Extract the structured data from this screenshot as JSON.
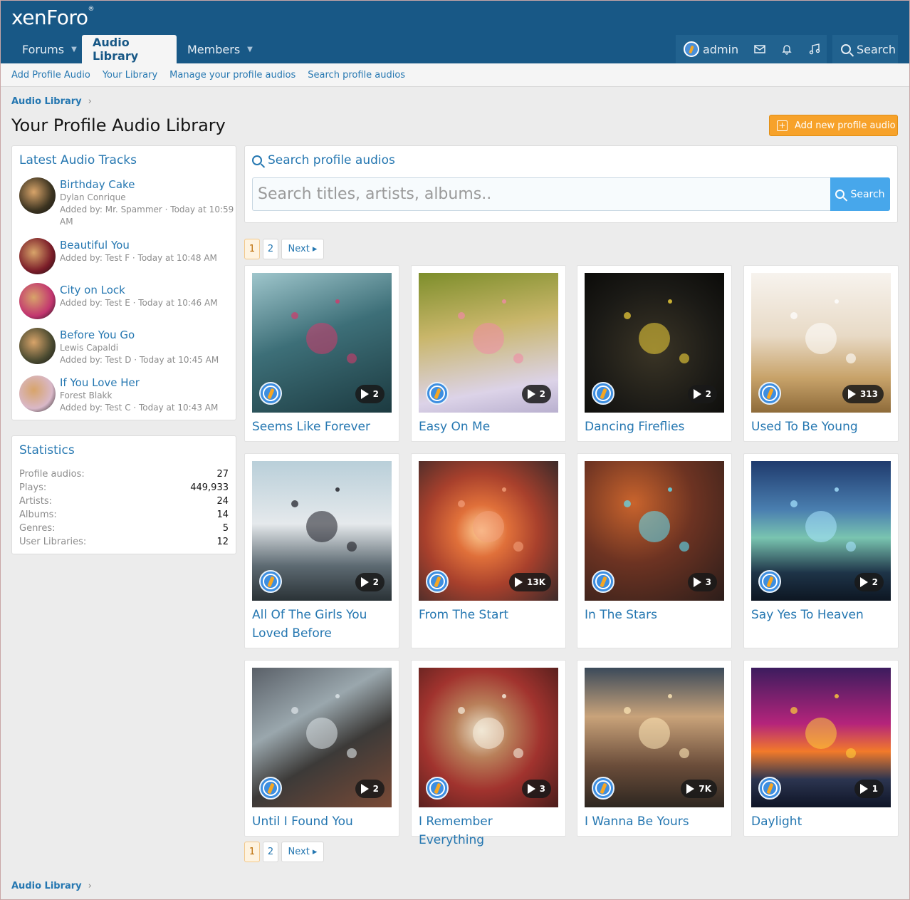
{
  "header": {
    "logo": "xenForo",
    "nav": [
      {
        "label": "Forums"
      },
      {
        "label": "Audio Library"
      },
      {
        "label": "Members"
      }
    ],
    "user": {
      "name": "admin",
      "search_label": "Search"
    }
  },
  "subnav": [
    "Add Profile Audio",
    "Your Library",
    "Manage your profile audios",
    "Search profile audios"
  ],
  "breadcrumb": "Audio Library",
  "page_title": "Your Profile Audio Library",
  "add_button": "Add new profile audio",
  "latest": {
    "title": "Latest Audio Tracks",
    "tracks": [
      {
        "title": "Birthday Cake",
        "artist": "Dylan Conrique",
        "added": "Added by: Mr. Spammer · Today at 10:59",
        "added2": "AM",
        "color": "#3b3320"
      },
      {
        "title": "Beautiful You",
        "artist": "",
        "added": "Added by: Test F · Today at 10:48 AM",
        "added2": "",
        "color": "#7a1c28"
      },
      {
        "title": "City on Lock",
        "artist": "",
        "added": "Added by: Test E · Today at 10:46 AM",
        "added2": "",
        "color": "#c2356f"
      },
      {
        "title": "Before You Go",
        "artist": "Lewis Capaldi",
        "added": "Added by: Test D · Today at 10:45 AM",
        "added2": "",
        "color": "#4a4a30"
      },
      {
        "title": "If You Love Her",
        "artist": "Forest Blakk",
        "added": "Added by: Test C · Today at 10:43 AM",
        "added2": "",
        "color": "#d9b8c8"
      }
    ]
  },
  "stats": {
    "title": "Statistics",
    "rows": [
      {
        "label": "Profile audios:",
        "value": "27"
      },
      {
        "label": "Plays:",
        "value": "449,933"
      },
      {
        "label": "Artists:",
        "value": "24"
      },
      {
        "label": "Albums:",
        "value": "14"
      },
      {
        "label": "Genres:",
        "value": "5"
      },
      {
        "label": "User Libraries:",
        "value": "12"
      }
    ]
  },
  "search": {
    "title": "Search profile audios",
    "placeholder": "Search titles, artists, albums..",
    "button": "Search"
  },
  "pager": {
    "pages": [
      "1",
      "2"
    ],
    "next": "Next ▸"
  },
  "cards": [
    {
      "name": "Seems Like Forever",
      "plays": "2",
      "bg": "linear-gradient(160deg,#9fc6cc 0%,#3d6f78 45%,#1c3a40 100%)",
      "accent": "#d13a6b"
    },
    {
      "name": "Easy On Me",
      "plays": "2",
      "bg": "linear-gradient(170deg,#7d8e2b 0%,#c9b66a 40%,#dcd3e8 80%,#b9b0cf 100%)",
      "accent": "#f08aa5"
    },
    {
      "name": "Dancing Fireflies",
      "plays": "2",
      "bg": "radial-gradient(circle at 50% 55%,#3b3526 0%,#1b1a16 60%,#0b0b09 100%)",
      "accent": "#f3d33a"
    },
    {
      "name": "Used To Be Young",
      "plays": "313",
      "bg": "linear-gradient(180deg,#f7f3ee 0%,#e8dac6 45%,#c8a36a 75%,#8e6b3a 100%)",
      "accent": "#ffffff"
    },
    {
      "name": "All Of The Girls You Loved Before",
      "plays": "2",
      "bg": "linear-gradient(180deg,#b9cfd9 0%,#e5e9ec 45%,#5d6a72 75%,#2a3236 100%)",
      "accent": "#1a1a22"
    },
    {
      "name": "From The Start",
      "plays": "13K",
      "bg": "radial-gradient(circle at 45% 50%,#ffd29a 0%,#e0703a 25%,#a8402c 55%,#3b2a2a 100%)",
      "accent": "#f3a07a"
    },
    {
      "name": "In The Stars",
      "plays": "3",
      "bg": "radial-gradient(circle at 35% 30%,#c9642d 0%,#6d3322 45%,#2b1d1a 100%)",
      "accent": "#5ee0f5"
    },
    {
      "name": "Say Yes To Heaven",
      "plays": "2",
      "bg": "linear-gradient(180deg,#1f3a6d 0%,#4a7fb0 35%,#79c4b0 55%,#1e3448 80%,#0d1622 100%)",
      "accent": "#a7e4ff"
    },
    {
      "name": "Until I Found You",
      "plays": "2",
      "bg": "linear-gradient(150deg,#5a6068 0%,#9aa7ad 35%,#3c3a38 60%,#7a4a36 100%)",
      "accent": "#dfe6ea"
    },
    {
      "name": "I Remember Everything",
      "plays": "3",
      "bg": "radial-gradient(circle at 45% 45%,#e9dfc7 0%,#b9805a 25%,#a1332e 55%,#4a1c1a 100%)",
      "accent": "#f7efe0"
    },
    {
      "name": "I Wanna Be Yours",
      "plays": "7K",
      "bg": "linear-gradient(180deg,#3b4a5a 0%,#c9a37a 35%,#6b4d3a 70%,#2d2620 100%)",
      "accent": "#ffe8b8"
    },
    {
      "name": "Daylight",
      "plays": "1",
      "bg": "linear-gradient(180deg,#3c1c5e 0%,#b4247b 40%,#f27a2a 60%,#2c3550 80%,#0e1426 100%)",
      "accent": "#ffce3a"
    }
  ]
}
